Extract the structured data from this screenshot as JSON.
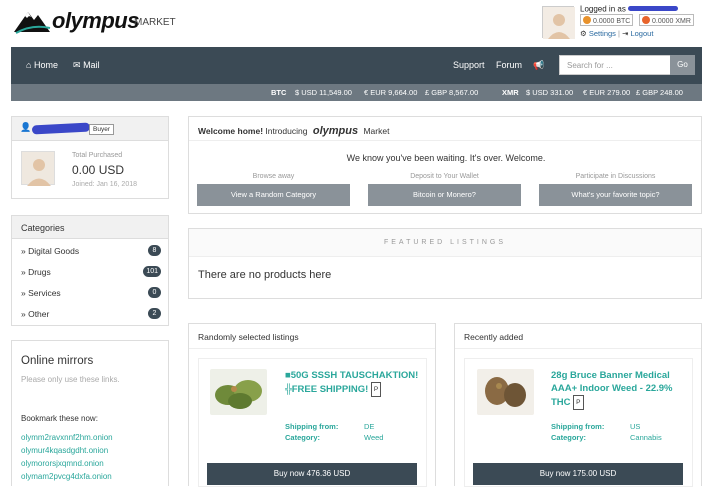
{
  "brand": {
    "name": "olympus",
    "tag": "MARKET"
  },
  "account": {
    "logged_in_label": "Logged in as",
    "btc_balance": "0.0000 BTC",
    "xmr_balance": "0.0000 XMR",
    "settings": "Settings",
    "logout": "Logout"
  },
  "nav": {
    "home": "Home",
    "mail": "Mail",
    "support": "Support",
    "forum": "Forum",
    "search_placeholder": "Search for ...",
    "go": "Go"
  },
  "ticker": {
    "btc_label": "BTC",
    "btc_usd": "$ USD 11,549.00",
    "btc_eur": "€ EUR 9,664.00",
    "btc_gbp": "£ GBP 8,567.00",
    "xmr_label": "XMR",
    "xmr_usd": "$ USD 331.00",
    "xmr_eur": "€ EUR 279.00",
    "xmr_gbp": "£ GBP 248.00"
  },
  "user": {
    "role_badge": "Buyer",
    "total_label": "Total Purchased",
    "total_value": "0.00 USD",
    "joined": "Joined: Jan 16, 2018"
  },
  "categories": {
    "title": "Categories",
    "items": [
      {
        "label": "» Digital Goods",
        "count": "8"
      },
      {
        "label": "» Drugs",
        "count": "101"
      },
      {
        "label": "» Services",
        "count": "0"
      },
      {
        "label": "» Other",
        "count": "2"
      }
    ]
  },
  "mirrors": {
    "title": "Online mirrors",
    "subtitle": "Please only use these links.",
    "bookmark": "Bookmark these now:",
    "links": [
      "olymm2ravxnnf2hm.onion",
      "olymur4kqasdgdht.onion",
      "olymororsjxqmnd.onion",
      "olymam2pvcg4dxfa.onion"
    ]
  },
  "welcome": {
    "bold": "Welcome home!",
    "intro": "Introducing",
    "brand": "olympus",
    "market": "Market",
    "message": "We know you've been waiting. It's over. Welcome.",
    "col1_label": "Browse away",
    "col1_button": "View a Random Category",
    "col2_label": "Deposit to Your Wallet",
    "col2_button": "Bitcoin or Monero?",
    "col3_label": "Participate in Discussions",
    "col3_button": "What's your favorite topic?"
  },
  "featured": {
    "title": "FEATURED LISTINGS",
    "empty": "There are no products here"
  },
  "random_listing": {
    "panel_title": "Randomly selected listings",
    "title": "■50G SSSH TAUSCHAKTION!╬FREE SHIPPING!",
    "badge": "P",
    "ship_label": "Shipping from:",
    "ship_value": "DE",
    "cat_label": "Category:",
    "cat_value": "Weed",
    "buy": "Buy now 476.36 USD"
  },
  "recent_listing": {
    "panel_title": "Recently added",
    "title": "28g Bruce Banner Medical AAA+ Indoor Weed - 22.9% THC",
    "badge": "P",
    "ship_label": "Shipping from:",
    "ship_value": "US",
    "cat_label": "Category:",
    "cat_value": "Cannabis",
    "buy": "Buy now 175.00 USD"
  },
  "colors": {
    "nav": "#3b4a55",
    "ticker": "#6d7881",
    "accent": "#2aa79b",
    "button": "#8a9299"
  }
}
